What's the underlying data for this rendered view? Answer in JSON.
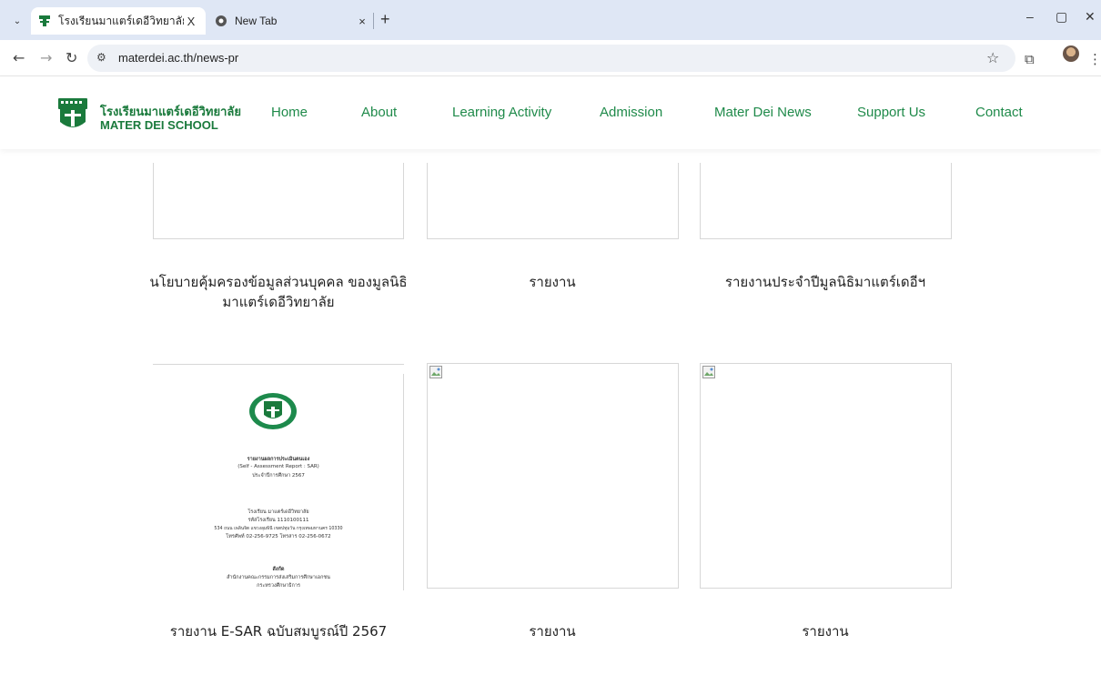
{
  "browser": {
    "tabs": [
      {
        "title": "โรงเรียนมาแตร์เดอีวิทยาลัย - อบรมเ",
        "close": "X"
      },
      {
        "title": "New Tab",
        "close": "×"
      }
    ],
    "new_tab": "+",
    "url": "materdei.ac.th/news-pr",
    "window_controls": {
      "minimize": "–",
      "restore": "▢",
      "close": "✕"
    }
  },
  "site": {
    "brand_th": "โรงเรียนมาแตร์เดอีวิทยาลัย",
    "brand_en": "MATER DEI SCHOOL",
    "brand_color": "#1a7a3c",
    "menu": [
      "Home",
      "About",
      "Learning Activity",
      "Admission",
      "Mater Dei News",
      "Support Us",
      "Contact"
    ]
  },
  "cards": {
    "row1": [
      "นโยบายคุ้มครองข้อมูลส่วนบุคคล ของมูลนิธิมาแตร์เดอีวิทยาลัย",
      "รายงาน",
      "รายงานประจำปีมูลนิธิมาแตร์เดอีฯ"
    ],
    "row2": [
      "รายงาน E-SAR ฉบับสมบูรณ์ปี 2567",
      "รายงาน",
      "รายงาน"
    ]
  },
  "document_thumbnail": {
    "lines": [
      "รายงานผลการประเมินตนเอง",
      "(Self - Assessment Report : SAR)",
      "ประจำปีการศึกษา 2567",
      "โรงเรียน มาแตร์เดอีวิทยาลัย",
      "รหัสโรงเรียน 1110100111",
      "534 ถนน เพลินจิต แขวงลุมพินี เขตปทุมวัน กรุงเทพมหานคร 10330",
      "โทรศัพท์ 02-256-9725 โทรสาร 02-256-0672",
      "สังกัด",
      "สำนักงานคณะกรรมการส่งเสริมการศึกษาเอกชน",
      "กระทรวงศึกษาธิการ"
    ]
  }
}
